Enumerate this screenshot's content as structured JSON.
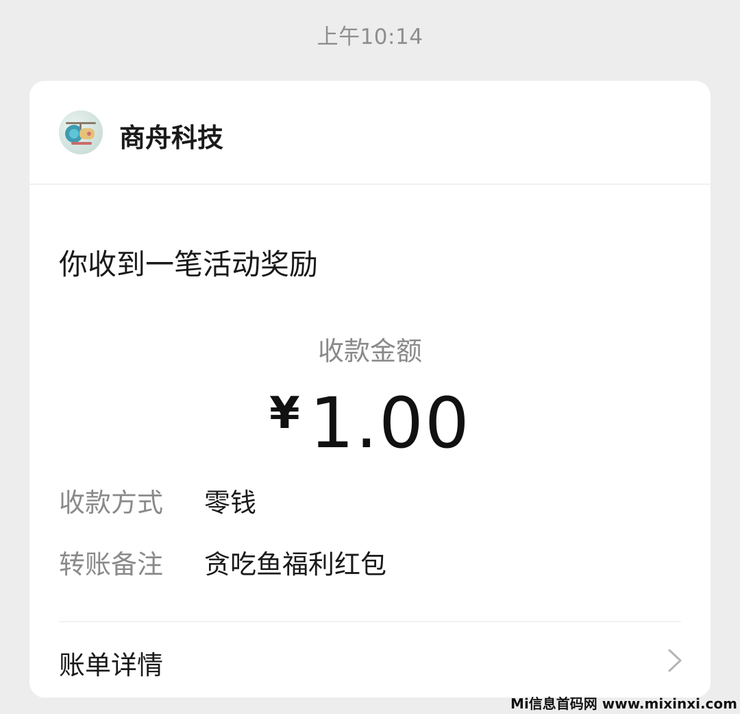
{
  "timestamp": "上午10:14",
  "sender": {
    "name": "商舟科技",
    "avatar_icon": "helicopter-avatar-icon"
  },
  "headline": "你收到一笔活动奖励",
  "amount": {
    "label": "收款金额",
    "currency": "¥",
    "value": "1.00"
  },
  "details": [
    {
      "key": "收款方式",
      "value": "零钱"
    },
    {
      "key": "转账备注",
      "value": "贪吃鱼福利红包"
    }
  ],
  "bill": {
    "label": "账单详情",
    "icon": "chevron-right-icon"
  },
  "watermark": "Mi信息首码网 www.mixinxi.com",
  "colors": {
    "background": "#ededed",
    "card": "#ffffff",
    "primary_text": "#1a1a1a",
    "secondary_text": "#8a8a8a"
  }
}
